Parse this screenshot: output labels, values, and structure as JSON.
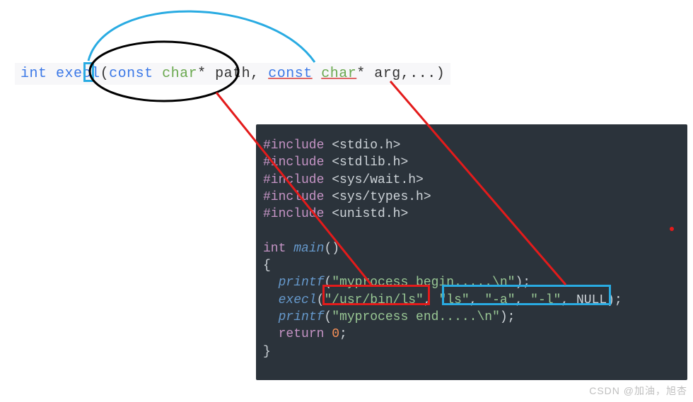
{
  "signature": {
    "ret_keyword": "int",
    "func_name_pre": "exec",
    "func_name_hl": "l",
    "open": "(",
    "param1_const": "const",
    "param1_type": "char",
    "param1_star": "*",
    "param1_name": "path",
    "comma": ",",
    "param2_const": "const",
    "param2_type": "char",
    "param2_star": "*",
    "param2_name": "arg",
    "ellipsis": ",...)",
    "close": ""
  },
  "code": {
    "l1_include": "#include",
    "l1_hdr": "<stdio.h>",
    "l2_include": "#include",
    "l2_hdr": "<stdlib.h>",
    "l3_include": "#include",
    "l3_hdr": "<sys/wait.h>",
    "l4_include": "#include",
    "l4_hdr": "<sys/types.h>",
    "l5_include": "#include",
    "l5_hdr": "<unistd.h>",
    "l7_int": "int",
    "l7_main": "main",
    "l7_rest": "()",
    "l8_open": "{",
    "l9_pre": "  ",
    "l9_fn": "printf",
    "l9_open": "(",
    "l9_str": "\"myprocess begin.....\\n\"",
    "l9_close": ");",
    "l10_pre": "  ",
    "l10_fn": "execl",
    "l10_open": "(",
    "l10_s1": "\"/usr/bin/ls\"",
    "l10_c1": ", ",
    "l10_s2": "\"ls\"",
    "l10_c2": ", ",
    "l10_s3": "\"-a\"",
    "l10_c3": ", ",
    "l10_s4": "\"-l\"",
    "l10_c4": ", ",
    "l10_null": "NULL",
    "l10_close": ");",
    "l11_pre": "  ",
    "l11_fn": "printf",
    "l11_open": "(",
    "l11_str": "\"myprocess end.....\\n\"",
    "l11_close": ");",
    "l12_pre": "  ",
    "l12_ret": "return",
    "l12_num": "0",
    "l12_semi": ";",
    "l13_close": "}"
  },
  "watermark": "CSDN @加油，旭杏"
}
